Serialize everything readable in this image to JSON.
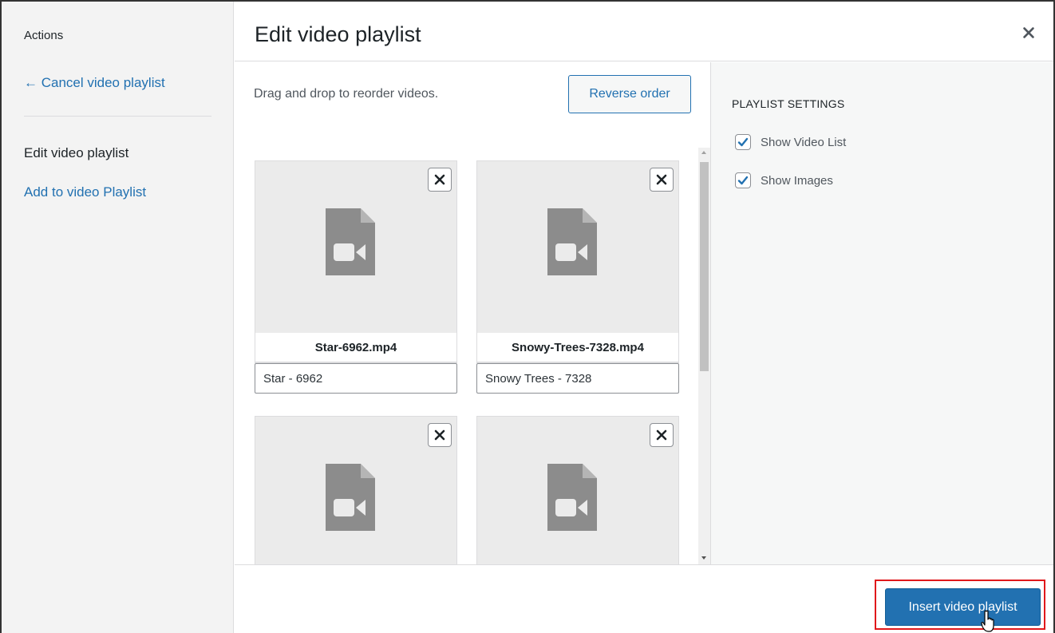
{
  "menu": {
    "heading": "Actions",
    "cancel_link": "← Cancel video playlist",
    "active_item": "Edit video playlist",
    "add_link": "Add to video Playlist"
  },
  "header": {
    "title": "Edit video playlist",
    "close_icon": "close-icon"
  },
  "content": {
    "instructions": "Drag and drop to reorder videos.",
    "reverse_button": "Reverse order",
    "items": [
      {
        "filename": "Star-6962.mp4",
        "caption": "Star - 6962",
        "icon": "video-file-icon"
      },
      {
        "filename": "Snowy-Trees-7328.mp4",
        "caption": "Snowy Trees - 7328",
        "icon": "video-file-icon"
      },
      {
        "filename": "",
        "caption": "",
        "icon": "video-file-icon"
      },
      {
        "filename": "",
        "caption": "",
        "icon": "video-file-icon"
      }
    ]
  },
  "settings": {
    "title": "PLAYLIST SETTINGS",
    "options": [
      {
        "label": "Show Video List",
        "checked": true
      },
      {
        "label": "Show Images",
        "checked": true
      }
    ]
  },
  "toolbar": {
    "insert_button": "Insert video playlist"
  },
  "colors": {
    "accent": "#2271b1",
    "highlight": "#e0181b",
    "menu_bg": "#f3f3f3",
    "thumb_bg": "#ebebeb",
    "icon_gray": "#8c8c8c"
  }
}
